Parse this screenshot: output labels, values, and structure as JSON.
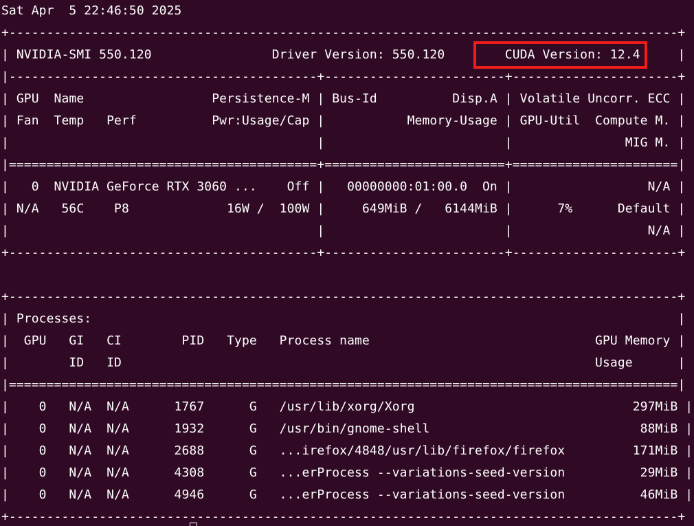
{
  "terminal": {
    "lines": [
      "Sat Apr  5 22:46:50 2025",
      "+-----------------------------------------------------------------------------------------+",
      "| NVIDIA-SMI 550.120                Driver Version: 550.120        CUDA Version: 12.4     |",
      "|-----------------------------------------+------------------------+----------------------+",
      "| GPU  Name                 Persistence-M | Bus-Id          Disp.A | Volatile Uncorr. ECC |",
      "| Fan  Temp   Perf          Pwr:Usage/Cap |           Memory-Usage | GPU-Util  Compute M. |",
      "|                                         |                        |               MIG M. |",
      "|=========================================+========================+======================|",
      "|   0  NVIDIA GeForce RTX 3060 ...    Off |   00000000:01:00.0  On |                  N/A |",
      "| N/A   56C    P8             16W /  100W |     649MiB /   6144MiB |      7%      Default |",
      "|                                         |                        |                  N/A |",
      "+-----------------------------------------+------------------------+----------------------+",
      "",
      "",
      "+-----------------------------------------------------------------------------------------+",
      "| Processes:                                                                              |",
      "|  GPU   GI   CI        PID   Type   Process name                              GPU Memory |",
      "|        ID   ID                                                               Usage      |",
      "|=========================================================================================|",
      "|    0   N/A  N/A      1767      G   /usr/lib/xorg/Xorg                             297MiB |",
      "|    0   N/A  N/A      1932      G   /usr/bin/gnome-shell                            88MiB |",
      "|    0   N/A  N/A      2688      G   ...irefox/4848/usr/lib/firefox/firefox         171MiB |",
      "|    0   N/A  N/A      4308      G   ...erProcess --variations-seed-version          29MiB |",
      "|    0   N/A  N/A      4946      G   ...erProcess --variations-seed-version          46MiB |",
      "+-----------------------------------------------------------------------------------------+"
    ]
  },
  "colors": {
    "background": "#300a24",
    "foreground": "#ffffff",
    "highlight": "#ef1c1c"
  }
}
